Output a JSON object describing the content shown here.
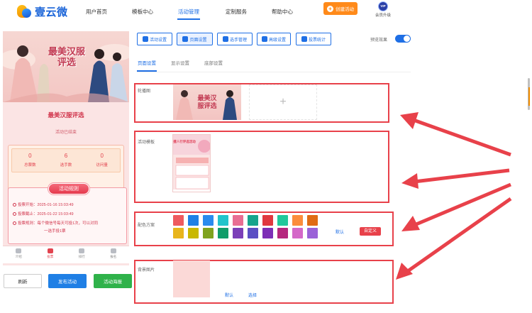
{
  "brand": {
    "name": "壹云微"
  },
  "nav": {
    "items": [
      "用户首页",
      "模板中心",
      "活动管理",
      "定制服务",
      "帮助中心"
    ],
    "create_label": "创建活动",
    "vip_badge": "VIP",
    "vip_label": "会员升级"
  },
  "preview": {
    "hero_title": "最美汉服评选",
    "title": "最美汉服评选",
    "status": "活动已结束",
    "stats": [
      {
        "value": "0",
        "label": "总票数"
      },
      {
        "value": "6",
        "label": "选手数"
      },
      {
        "value": "0",
        "label": "访问量"
      }
    ],
    "rules_title": "活动规则",
    "rules": [
      "投票开始：2025-01-16 15:03:49",
      "投票截止：2025-01-22 15:03:49",
      "投票规则：每个微信号每天可投1次，可以对同",
      "一选手投1票"
    ],
    "tabs": [
      "介绍",
      "投票",
      "排行",
      "报名"
    ],
    "template_mini_title": "捷人行评选活动"
  },
  "actions": {
    "refresh": "刷新",
    "publish": "发布活动",
    "poster": "活动海报"
  },
  "toolbar": {
    "buttons": [
      "活动设置",
      "页面设置",
      "选手管理",
      "高级设置",
      "投票统计"
    ],
    "preview_label": "预览效果"
  },
  "subtabs": [
    "页面设置",
    "显示设置",
    "底部设置"
  ],
  "sections": {
    "carousel": {
      "label": "轮播图",
      "add": "+"
    },
    "template": {
      "label": "活动模板"
    },
    "colors": {
      "label": "配色方案",
      "palette": [
        "#ee5a5f",
        "#1f80e5",
        "#2a8bed",
        "#22c4cb",
        "#e86e93",
        "#16a48c",
        "#e0383f",
        "#21c89b",
        "#fb8c3c",
        "#e06b14",
        "#e8b51c",
        "#c9b800",
        "#7fa31e",
        "#109d6a",
        "#7b3fb8",
        "#5a4fc4",
        "#7d2fb6",
        "#b5277e",
        "#d468c8",
        "#9b62d8"
      ],
      "default_label": "默认",
      "custom_label": "自定义"
    },
    "background": {
      "label": "背景图片",
      "default_label": "默认",
      "choose_label": "选择"
    }
  },
  "accent": {
    "primary": "#1f6fe5",
    "annotation": "#e8414a",
    "create": "#ff8a1a"
  }
}
